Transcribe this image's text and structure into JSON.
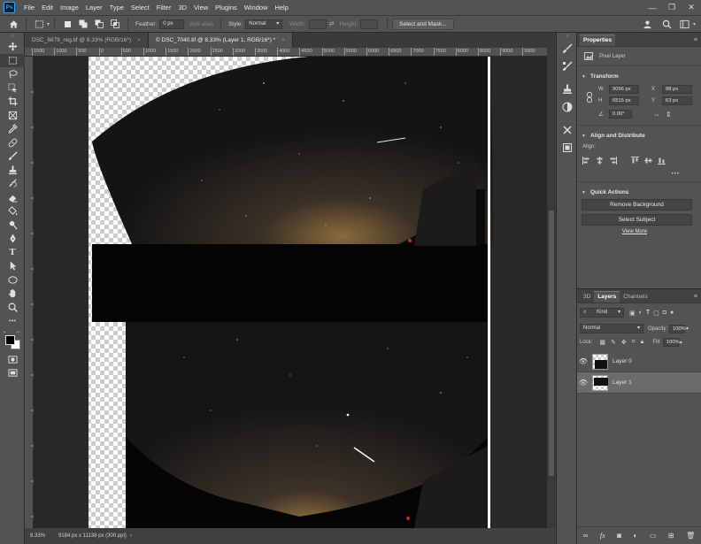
{
  "menubar": {
    "logo": "Ps",
    "items": [
      "File",
      "Edit",
      "Image",
      "Layer",
      "Type",
      "Select",
      "Filter",
      "3D",
      "View",
      "Plugins",
      "Window",
      "Help"
    ],
    "window_controls": [
      "—",
      "❐",
      "✕"
    ]
  },
  "options_bar": {
    "feather_label": "Feather:",
    "feather_value": "0 px",
    "antialias_label": "Anti-alias",
    "style_label": "Style:",
    "style_value": "Normal",
    "width_label": "Width:",
    "height_label": "Height:",
    "select_mask_button": "Select and Mask..."
  },
  "tabs": [
    {
      "label": "DSC_6879_reg.tif @ 8.33% (RGB/16*)",
      "active": false
    },
    {
      "label": "© DSC_7040.tif @ 8.33% (Layer 1, RGB/16*) *",
      "active": true
    }
  ],
  "ruler": {
    "labels": [
      "1500",
      "1000",
      "500",
      "0",
      "500",
      "1000",
      "1500",
      "2000",
      "2500",
      "3000",
      "3500",
      "4000",
      "4500",
      "5000",
      "5500",
      "6000",
      "6500",
      "7000",
      "7500",
      "8000",
      "8500",
      "9000",
      "9500"
    ]
  },
  "status": {
    "zoom": "8.33%",
    "doc_info": "9184 px x 11138 px (300 ppi)"
  },
  "properties": {
    "tab_label": "Properties",
    "layer_kind": "Pixel Layer",
    "transform_title": "Transform",
    "w_label": "W",
    "w_value": "9056 px",
    "h_label": "H",
    "h_value": "6515 px",
    "x_label": "X",
    "x_value": "88 px",
    "y_label": "Y",
    "y_value": "63 px",
    "angle_value": "0.00°",
    "align_title": "Align and Distribute",
    "align_label": "Align:",
    "more": "•••",
    "quick_title": "Quick Actions",
    "remove_bg": "Remove Background",
    "select_subject": "Select Subject",
    "view_more": "View More"
  },
  "layers_panel": {
    "tabs": [
      "3D",
      "Layers",
      "Channels"
    ],
    "active_tab": "Layers",
    "filter_kind": "Kind",
    "blend_mode": "Normal",
    "opacity_label": "Opacity:",
    "opacity_value": "100%",
    "lock_label": "Lock:",
    "fill_label": "Fill:",
    "fill_value": "100%",
    "layers": [
      {
        "name": "Layer 0",
        "selected": false,
        "visible": true
      },
      {
        "name": "Layer 1",
        "selected": true,
        "visible": true
      }
    ],
    "footer_icons": [
      "link-icon",
      "fx-icon",
      "mask-icon",
      "adjustment-icon",
      "group-icon",
      "new-layer-icon",
      "trash-icon"
    ]
  },
  "colors": {
    "accent": "#31a8ff",
    "panel": "#535353",
    "dark": "#282828",
    "selected_layer": "#6b6b6b"
  }
}
